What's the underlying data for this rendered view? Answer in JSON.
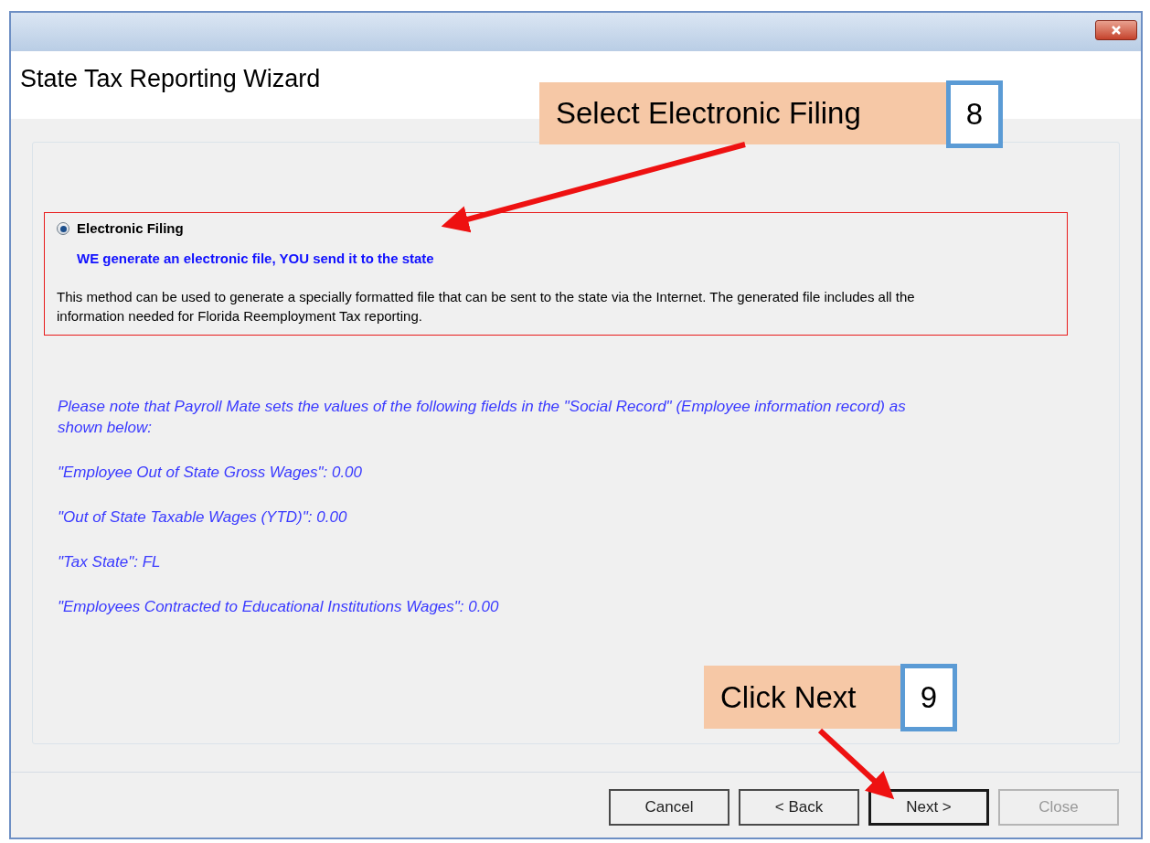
{
  "window": {
    "title": "State Tax Reporting Wizard"
  },
  "options": [
    {
      "label": "Electronic Filing",
      "subtitle": "WE generate an electronic file, YOU send it to the state",
      "description": "This method can be used to generate a specially formatted file that can be sent to the state via the Internet. The generated file includes all the information needed for Florida Reemployment Tax reporting.",
      "selected": true
    }
  ],
  "notes": [
    "Please note that Payroll Mate sets the values of the following fields in the \"Social Record\" (Employee information record) as shown below:",
    "\"Employee Out of State Gross Wages\":  0.00",
    "\"Out of State Taxable Wages (YTD)\":  0.00",
    "\"Tax State\":  FL",
    "\"Employees Contracted to Educational Institutions Wages\":  0.00"
  ],
  "buttons": [
    {
      "label": "Cancel",
      "disabled": false,
      "default": false
    },
    {
      "label": "< Back",
      "disabled": false,
      "default": false
    },
    {
      "label": "Next >",
      "disabled": false,
      "default": true
    },
    {
      "label": "Close",
      "disabled": true,
      "default": false
    }
  ],
  "callouts": [
    {
      "text": "Select Electronic Filing",
      "step": "8"
    },
    {
      "text": "Click Next",
      "step": "9"
    }
  ]
}
